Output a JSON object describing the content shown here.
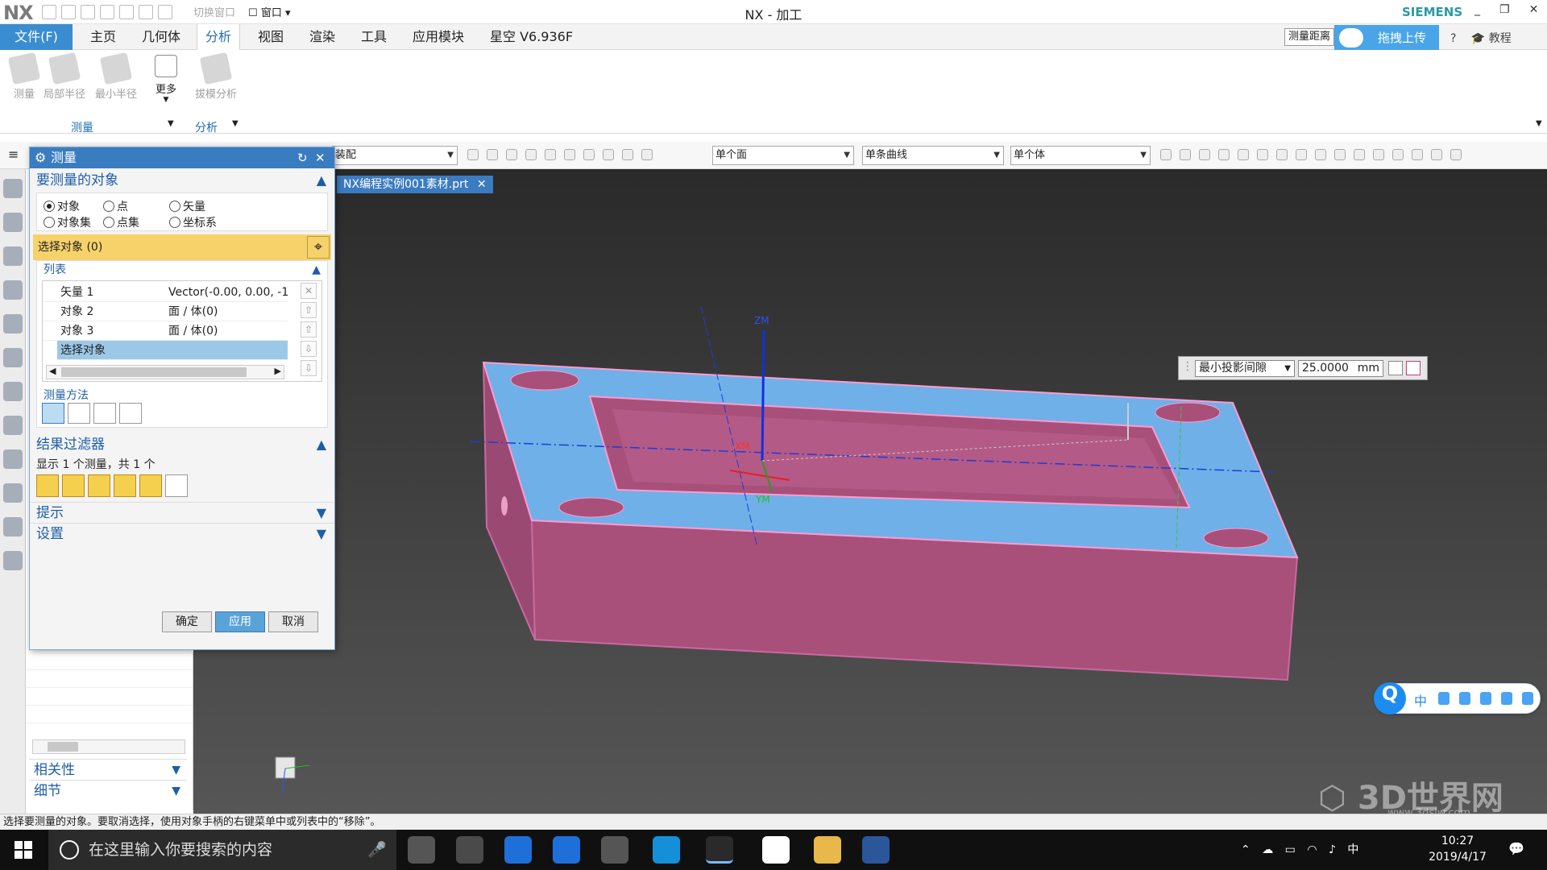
{
  "app": {
    "logo": "NX",
    "window_title": "NX - 加工",
    "brand": "SIEMENS",
    "switch_window": "切换窗口",
    "window_menu": "窗口"
  },
  "menu": {
    "file": "文件(F)",
    "tabs": [
      "主页",
      "几何体",
      "分析",
      "视图",
      "渲染",
      "工具",
      "应用模块",
      "星空 V6.936F"
    ],
    "active_tab": "分析",
    "measure_distance": "测量距离",
    "upload": "拖拽上传",
    "tutorial": "教程"
  },
  "ribbon": {
    "buttons": [
      {
        "label": "测量",
        "enabled": false
      },
      {
        "label": "局部半径",
        "enabled": false
      },
      {
        "label": "最小半径",
        "enabled": false
      },
      {
        "label": "更多",
        "enabled": true
      },
      {
        "label": "拔模分析",
        "enabled": false
      }
    ],
    "groups": [
      "测量",
      "分析"
    ]
  },
  "selection_bar": {
    "assembly_filter": "装配",
    "face_rule": "单个面",
    "curve_rule": "单条曲线",
    "body_rule": "单个体"
  },
  "document_tab": {
    "name": "NX编程实例001素材.prt"
  },
  "dialog": {
    "title": "测量",
    "section_objects": "要测量的对象",
    "radio_options": [
      "对象",
      "点",
      "矢量",
      "对象集",
      "点集",
      "坐标系"
    ],
    "selected_radio": "对象",
    "select_object": "选择对象 (0)",
    "list_title": "列表",
    "list_rows": [
      {
        "name": "矢量 1",
        "value": "Vector(-0.00, 0.00, -1"
      },
      {
        "name": "对象 2",
        "value": "面 / 体(0)"
      },
      {
        "name": "对象 3",
        "value": "面 / 体(0)"
      },
      {
        "name": "选择对象",
        "value": ""
      }
    ],
    "method_label": "测量方法",
    "filter_title": "结果过滤器",
    "filter_info": "显示 1 个测量，共 1 个",
    "hint_title": "提示",
    "settings_title": "设置",
    "ok": "确定",
    "apply": "应用",
    "cancel": "取消"
  },
  "navigator": {
    "related": "相关性",
    "details": "细节"
  },
  "readout": {
    "type": "最小投影间隙",
    "value": "25.0000",
    "unit": "mm"
  },
  "viewport_labels": {
    "zm": "ZM",
    "xm": "XM",
    "ym": "YM"
  },
  "status_text": "选择要测量的对象。要取消选择，使用对象手柄的右键菜单中或列表中的“移除”。",
  "taskbar": {
    "search_placeholder": "在这里输入你要搜索的内容",
    "time": "10:27",
    "date": "2019/4/17",
    "ime_lang": "中"
  },
  "watermark": {
    "text": "3D世界网",
    "url": "www.3dsjw.com"
  },
  "colors": {
    "accent": "#3a8dd0",
    "part_top": "#6fb0e8",
    "part_side": "#a8507a",
    "highlight": "#f7d26a"
  }
}
